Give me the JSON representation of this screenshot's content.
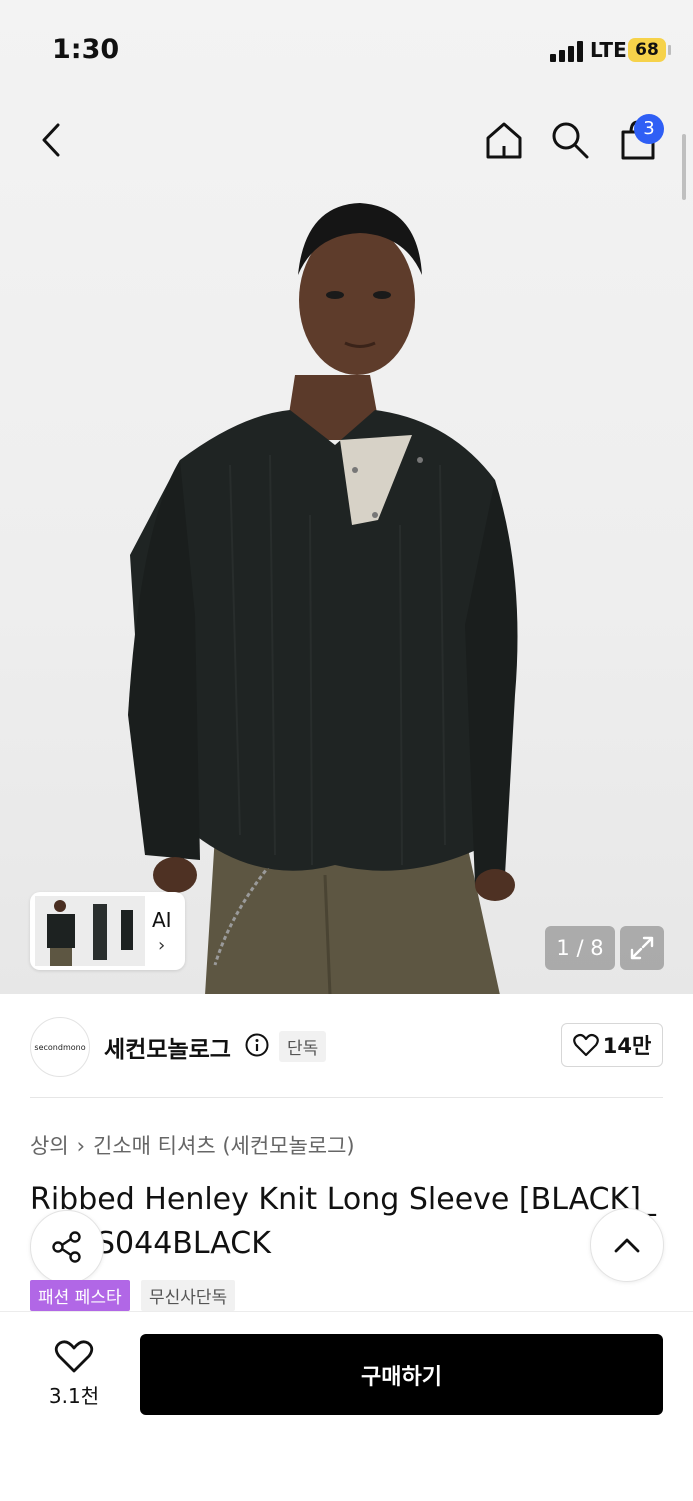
{
  "status_bar": {
    "time": "1:30",
    "network": "LTE",
    "battery": "68"
  },
  "nav": {
    "cart_count": "3"
  },
  "gallery": {
    "ai_label": "AI",
    "counter": "1 / 8"
  },
  "brand": {
    "logo_text": "secondmono",
    "name": "세컨모놀로그",
    "exclusive_tag": "단독",
    "likes": "14만"
  },
  "breadcrumb": {
    "category": "상의",
    "subcategory": "긴소매 티셔츠 (세컨모놀로그)"
  },
  "product": {
    "title_line1": "Ribbed Henley Knit Long Sleeve [BLACK]_",
    "title_line2": "S044BLACK"
  },
  "tags": {
    "festa": "패션 페스타",
    "musinsa": "무신사단독"
  },
  "bottom": {
    "wish_count": "3.1천",
    "buy_label": "구매하기"
  },
  "colors": {
    "accent_blue": "#2f5ff5",
    "festa_purple": "#b167e6",
    "buy_black": "#000000",
    "battery_yellow": "#f6d24a"
  }
}
